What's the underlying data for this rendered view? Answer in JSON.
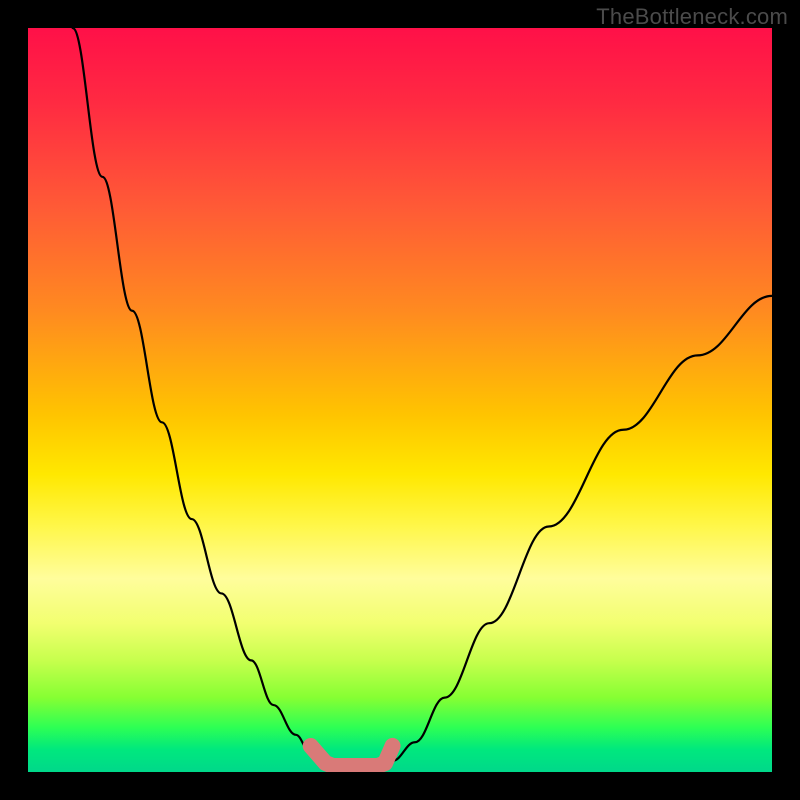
{
  "watermark": "TheBottleneck.com",
  "chart_data": {
    "type": "line",
    "title": "",
    "xlabel": "",
    "ylabel": "",
    "xlim": [
      0,
      100
    ],
    "ylim": [
      0,
      100
    ],
    "series": [
      {
        "name": "left-curve",
        "x": [
          6,
          10,
          14,
          18,
          22,
          26,
          30,
          33,
          36,
          38,
          40,
          41
        ],
        "y": [
          100,
          80,
          62,
          47,
          34,
          24,
          15,
          9,
          5,
          2.5,
          1.2,
          0.8
        ]
      },
      {
        "name": "right-curve",
        "x": [
          47,
          49,
          52,
          56,
          62,
          70,
          80,
          90,
          100
        ],
        "y": [
          0.8,
          1.5,
          4,
          10,
          20,
          33,
          46,
          56,
          64
        ]
      },
      {
        "name": "marker-band",
        "x": [
          38,
          40,
          41,
          43,
          45,
          47,
          48,
          49
        ],
        "y": [
          3.5,
          1.2,
          0.8,
          0.8,
          0.8,
          0.8,
          1.2,
          3.5
        ]
      }
    ],
    "colors": {
      "curve": "#000000",
      "marker": "#d97a78"
    }
  }
}
